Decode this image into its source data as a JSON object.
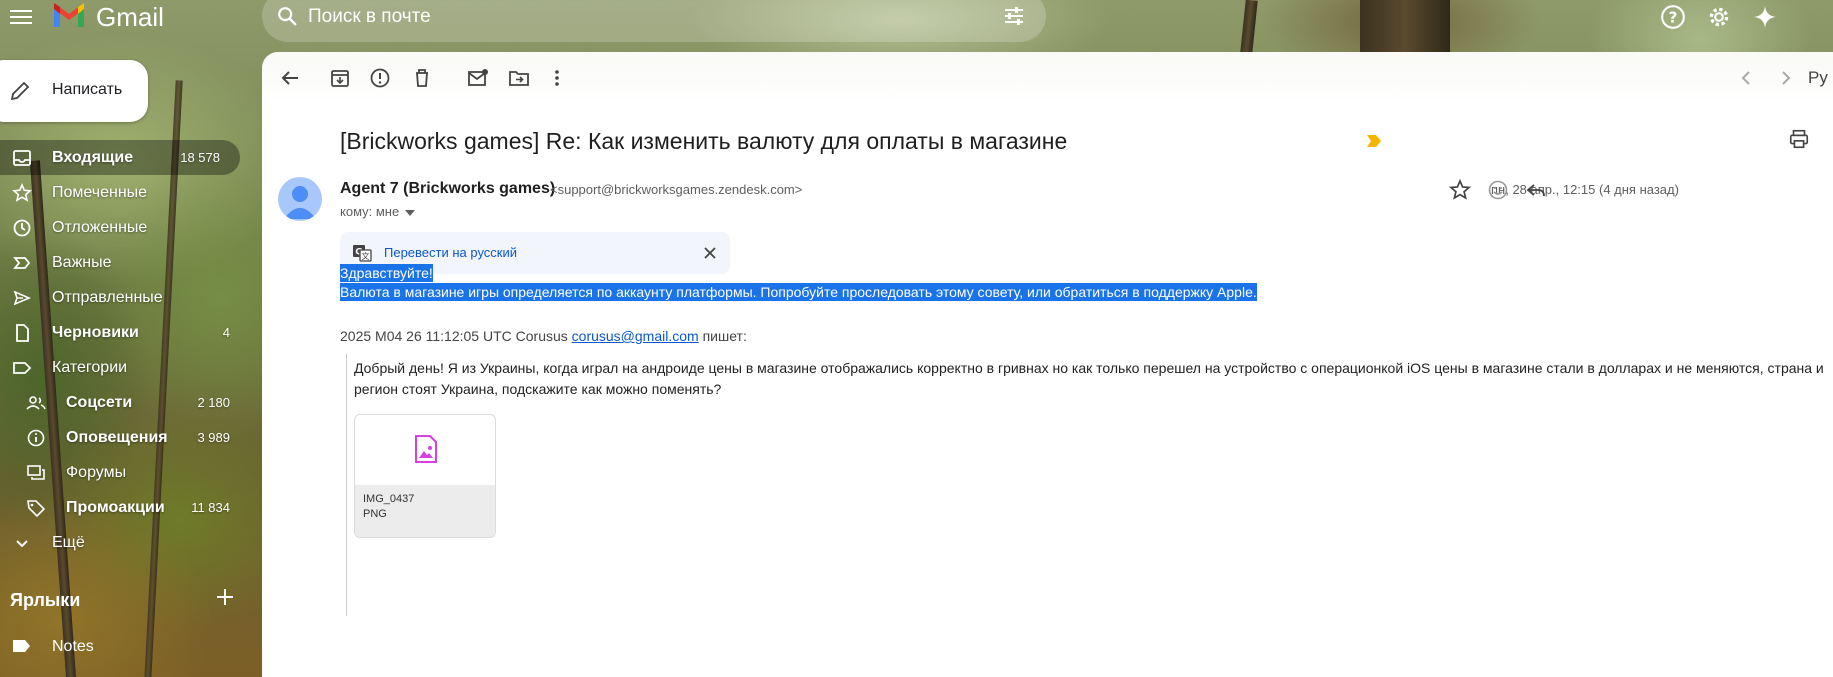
{
  "app": {
    "name": "Gmail"
  },
  "search": {
    "placeholder": "Поиск в почте"
  },
  "compose": {
    "label": "Написать"
  },
  "sidebar": {
    "items": [
      {
        "label": "Входящие",
        "count": "18 578"
      },
      {
        "label": "Помеченные",
        "count": ""
      },
      {
        "label": "Отложенные",
        "count": ""
      },
      {
        "label": "Важные",
        "count": ""
      },
      {
        "label": "Отправленные",
        "count": ""
      },
      {
        "label": "Черновики",
        "count": "4"
      },
      {
        "label": "Категории",
        "count": ""
      },
      {
        "label": "Соцсети",
        "count": "2 180"
      },
      {
        "label": "Оповещения",
        "count": "3 989"
      },
      {
        "label": "Форумы",
        "count": ""
      },
      {
        "label": "Промоакции",
        "count": "11 834"
      },
      {
        "label": "Ещё",
        "count": ""
      }
    ],
    "labels_header": "Ярлыки",
    "labels": [
      {
        "label": "Notes"
      }
    ]
  },
  "toolbar": {
    "lang": "Ру"
  },
  "email": {
    "subject": "[Brickworks games] Re: Как изменить валюту для оплаты в магазине",
    "sender_name": "Agent 7 (Brickworks games)",
    "sender_email": "<support@brickworksgames.zendesk.com>",
    "to": "кому: мне",
    "date": "пн, 28 апр., 12:15 (4 дня назад)",
    "translate_label": "Перевести на русский",
    "body_line1": "Здравствуйте!",
    "body_line2": "Валюта в магазине игры определяется по аккаунту платформы. Попробуйте проследовать этому совету, или обратиться в поддержку Apple.",
    "quote_intro_prefix": "2025 M04 26 11:12:05 UTC Corusus ",
    "quote_email": "corusus@gmail.com",
    "quote_intro_suffix": " пишет:",
    "quote_text": "Добрый день! Я из Украины, когда играл на андроиде цены в магазине отображались корректно в гривнах но как только перешел на устройство с операционкой iOS цены в магазине стали в долларах и не меняются, страна и регион стоят Украина, подскажите как можно поменять?",
    "attachment": {
      "name": "IMG_0437",
      "type": "PNG"
    }
  },
  "colors": {
    "accent": "#0b57d0",
    "selection": "#1a73e8",
    "important": "#f4b400",
    "attachment_icon": "#d93fe0"
  }
}
